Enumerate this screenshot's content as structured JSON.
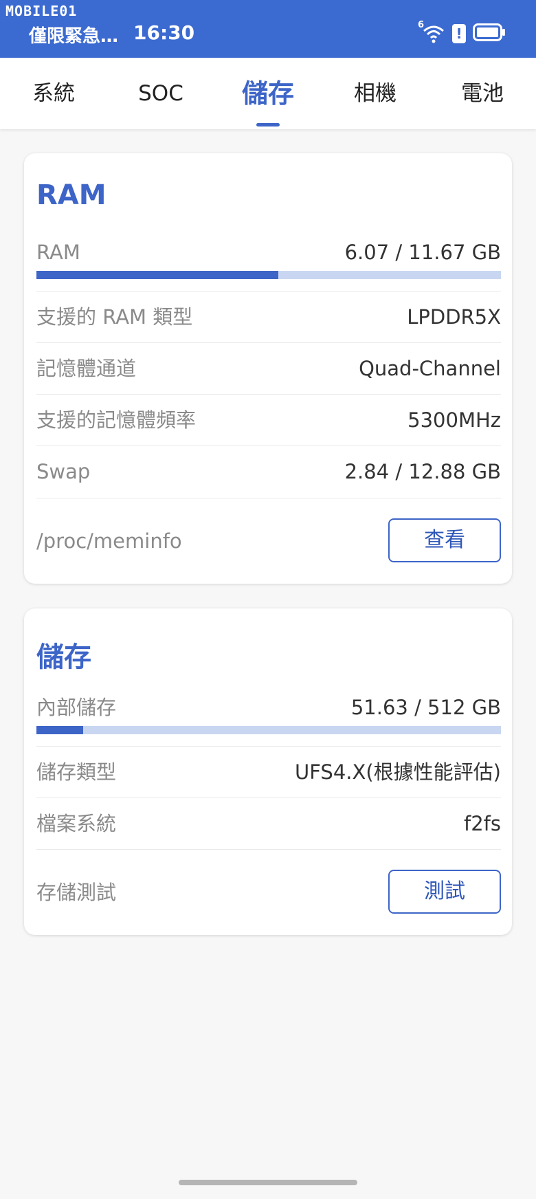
{
  "status_bar": {
    "watermark": "MOBILE01",
    "notification": "僅限緊急…",
    "time": "16:30",
    "signal_badge": "6",
    "alert_badge": "!"
  },
  "tabs": [
    {
      "label": "系統",
      "active": false
    },
    {
      "label": "SOC",
      "active": false
    },
    {
      "label": "儲存",
      "active": true
    },
    {
      "label": "相機",
      "active": false
    },
    {
      "label": "電池",
      "active": false
    }
  ],
  "ram_card": {
    "title": "RAM",
    "usage": {
      "label": "RAM",
      "value": "6.07 / 11.67 GB",
      "fill_fraction": 0.52
    },
    "rows": [
      {
        "label": "支援的 RAM 類型",
        "value": "LPDDR5X"
      },
      {
        "label": "記憶體通道",
        "value": "Quad-Channel"
      },
      {
        "label": "支援的記憶體頻率",
        "value": "5300MHz"
      },
      {
        "label": "Swap",
        "value": "2.84 / 12.88 GB"
      }
    ],
    "action": {
      "label": "/proc/meminfo",
      "button": "查看"
    }
  },
  "storage_card": {
    "title": "儲存",
    "usage": {
      "label": "內部儲存",
      "value": "51.63 / 512 GB",
      "fill_fraction": 0.1
    },
    "rows": [
      {
        "label": "儲存類型",
        "value": "UFS4.X(根據性能評估)"
      },
      {
        "label": "檔案系統",
        "value": "f2fs"
      }
    ],
    "action": {
      "label": "存儲測試",
      "button": "測試"
    }
  },
  "colors": {
    "accent": "#3d65c8",
    "status_bar": "#3b6ad0",
    "bar_track": "#c9d6f1"
  },
  "icons": {
    "wifi": "wifi-icon",
    "alert": "alert-icon",
    "battery": "battery-icon"
  }
}
